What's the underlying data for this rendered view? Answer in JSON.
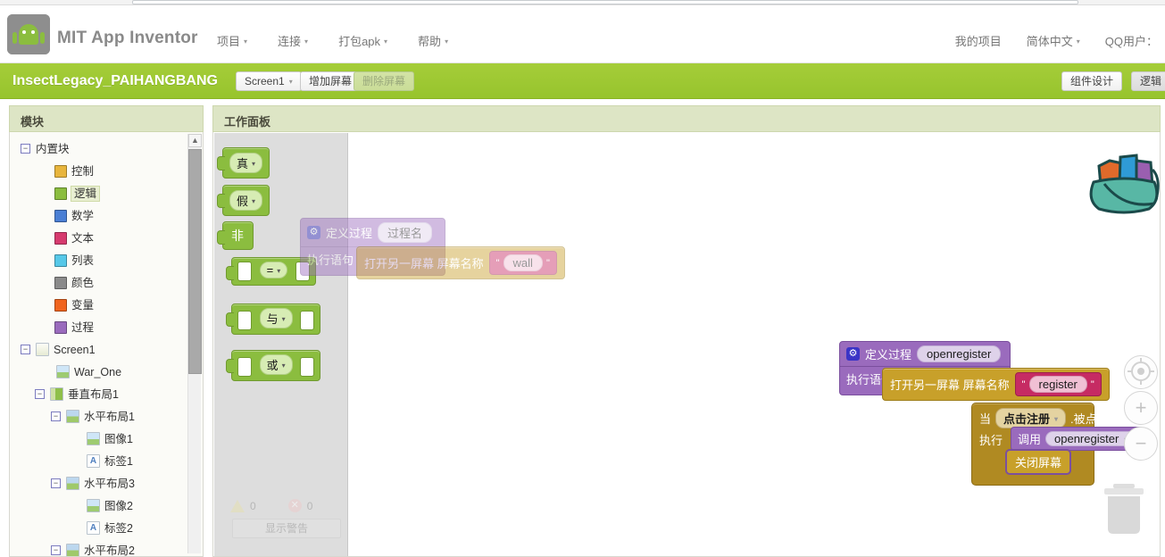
{
  "browser": {
    "url_placeholder": ""
  },
  "header": {
    "brand": "MIT App Inventor",
    "logo_icon": "android-robot-logo",
    "menu_left": [
      {
        "label": "项目",
        "caret": "▾",
        "icon": "chevron-down-icon"
      },
      {
        "label": "连接",
        "caret": "▾",
        "icon": "chevron-down-icon"
      },
      {
        "label": "打包apk",
        "caret": "▾",
        "icon": "chevron-down-icon"
      },
      {
        "label": "帮助",
        "caret": "▾",
        "icon": "chevron-down-icon"
      }
    ],
    "menu_right": [
      {
        "label": "我的项目",
        "caret": ""
      },
      {
        "label": "简体中文",
        "caret": "▾"
      },
      {
        "label": "QQ用户：",
        "caret": ""
      }
    ]
  },
  "project_bar": {
    "project_name": "InsectLegacy_PAIHANGBANG",
    "screen_select": "Screen1",
    "screen_select_caret": "▾",
    "add_screen": "增加屏幕",
    "delete_screen": "删除屏幕",
    "designer_tab": "组件设计",
    "blocks_tab": "逻辑"
  },
  "panels": {
    "blocks_title": "模块",
    "viewer_title": "工作面板"
  },
  "sidebar": {
    "builtin": {
      "label": "内置块",
      "toggle": "−",
      "items": [
        {
          "label": "控制",
          "color": "#e8b53c"
        },
        {
          "label": "逻辑",
          "color": "#8bbd3f",
          "selected": true
        },
        {
          "label": "数学",
          "color": "#4a7fd4"
        },
        {
          "label": "文本",
          "color": "#d63a6e"
        },
        {
          "label": "列表",
          "color": "#56c8e8"
        },
        {
          "label": "颜色",
          "color": "#8a8a8a"
        },
        {
          "label": "变量",
          "color": "#f0641e"
        },
        {
          "label": "过程",
          "color": "#9a6bbd"
        }
      ]
    },
    "screen": {
      "label": "Screen1",
      "toggle": "−",
      "children": [
        {
          "label": "War_One",
          "icon": "image-icon",
          "depth": 1,
          "toggle": ""
        },
        {
          "label": "垂直布局1",
          "icon": "vertical-arrangement-icon",
          "depth": 1,
          "toggle": "−"
        },
        {
          "label": "水平布局1",
          "icon": "horizontal-arrangement-icon",
          "depth": 2,
          "toggle": "−"
        },
        {
          "label": "图像1",
          "icon": "image-icon",
          "depth": 3,
          "toggle": ""
        },
        {
          "label": "标签1",
          "icon": "label-icon",
          "depth": 3,
          "toggle": ""
        },
        {
          "label": "水平布局3",
          "icon": "horizontal-arrangement-icon",
          "depth": 2,
          "toggle": "−"
        },
        {
          "label": "图像2",
          "icon": "image-icon",
          "depth": 3,
          "toggle": ""
        },
        {
          "label": "标签2",
          "icon": "label-icon",
          "depth": 3,
          "toggle": ""
        },
        {
          "label": "水平布局2",
          "icon": "horizontal-arrangement-icon",
          "depth": 2,
          "toggle": "−"
        }
      ]
    }
  },
  "flyout": {
    "blocks": [
      {
        "label": "真",
        "caret": "▾",
        "name": "true-block"
      },
      {
        "label": "假",
        "caret": "▾",
        "name": "false-block"
      },
      {
        "label": "非",
        "caret": "",
        "name": "not-block"
      },
      {
        "label": "=",
        "caret": "▾",
        "name": "equals-block"
      },
      {
        "label": "与",
        "caret": "▾",
        "name": "and-block"
      },
      {
        "label": "或",
        "caret": "▾",
        "name": "or-block"
      }
    ],
    "warning_count": "0",
    "error_count": "0",
    "show_warnings": "显示警告"
  },
  "workspace": {
    "ghost_procedure": {
      "define_label": "定义过程",
      "proc_name": "过程名",
      "do_label": "执行语句",
      "gear_icon": "gear-icon"
    },
    "ghost_open_screen": {
      "label": "打开另一屏幕 屏幕名称",
      "screen_value": "wall",
      "quote": "\""
    },
    "procedure": {
      "define_label": "定义过程",
      "proc_name": "openregister",
      "do_label": "执行语句",
      "gear_icon": "gear-icon"
    },
    "open_screen": {
      "label": "打开另一屏幕 屏幕名称",
      "screen_value": "register",
      "quote": "\""
    },
    "event": {
      "when": "当",
      "component": "点击注册",
      "component_caret": "▾",
      "event_name": ".被点击",
      "do_label": "执行",
      "call_label": "调用",
      "call_proc": "openregister",
      "call_caret": "▾",
      "close_screen": "关闭屏幕"
    },
    "controls": {
      "backpack_icon": "backpack-icon",
      "center_icon": "center-target-icon",
      "zoom_in": "+",
      "zoom_out": "−",
      "trash_icon": "trash-can-icon"
    }
  }
}
